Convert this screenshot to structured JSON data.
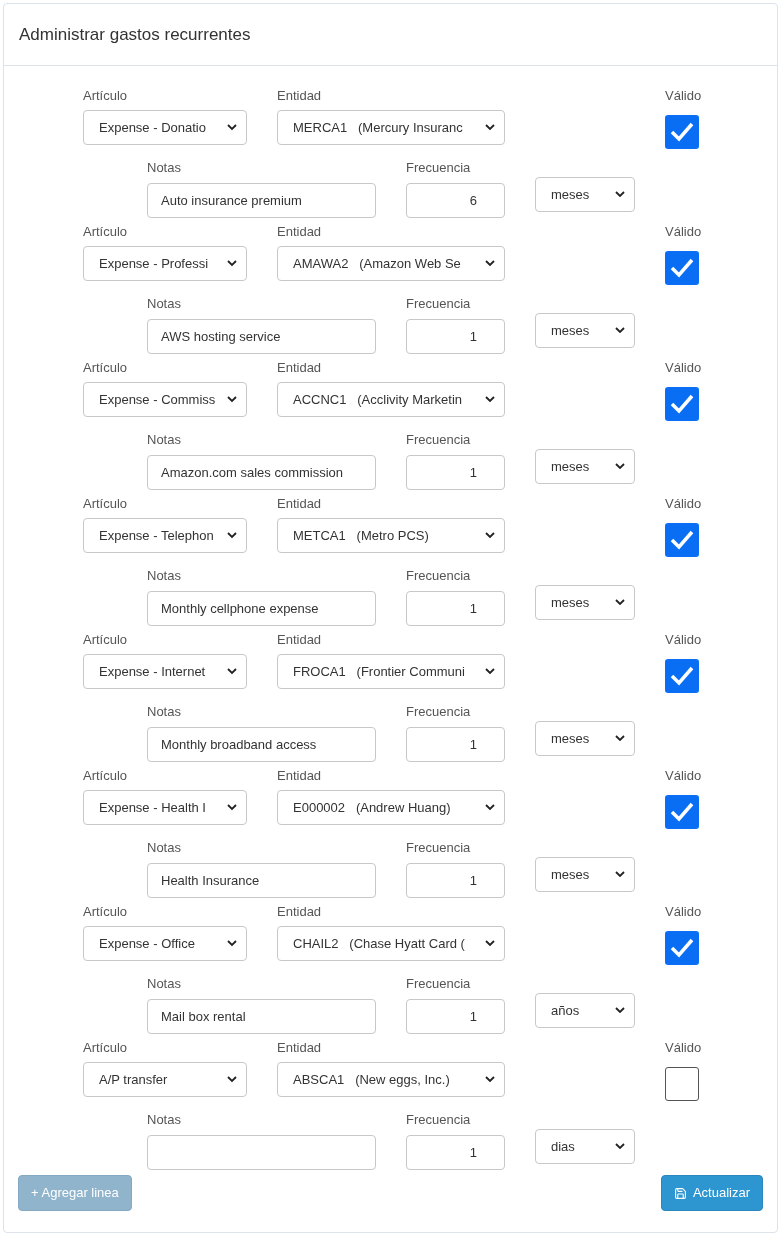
{
  "panel": {
    "title": "Administrar gastos recurrentes"
  },
  "rows": [
    {
      "item_label": "Artículo",
      "item": "Expense - Donatio",
      "entity_label": "Entidad",
      "entity": "MERCA1   (Mercury Insuranc",
      "valid_label": "Válido",
      "valid": true,
      "notes_label": "Notas",
      "notes": "Auto insurance premium",
      "frequency_label": "Frecuencia",
      "frequency": "6",
      "unit": "meses"
    },
    {
      "item_label": "Artículo",
      "item": "Expense - Professi",
      "entity_label": "Entidad",
      "entity": "AMAWA2   (Amazon Web Se",
      "valid_label": "Válido",
      "valid": true,
      "notes_label": "Notas",
      "notes": "AWS hosting service",
      "frequency_label": "Frecuencia",
      "frequency": "1",
      "unit": "meses"
    },
    {
      "item_label": "Artículo",
      "item": "Expense - Commiss",
      "entity_label": "Entidad",
      "entity": "ACCNC1   (Acclivity Marketin",
      "valid_label": "Válido",
      "valid": true,
      "notes_label": "Notas",
      "notes": "Amazon.com sales commission",
      "frequency_label": "Frecuencia",
      "frequency": "1",
      "unit": "meses"
    },
    {
      "item_label": "Artículo",
      "item": "Expense - Telephon",
      "entity_label": "Entidad",
      "entity": "METCA1   (Metro PCS)",
      "valid_label": "Válido",
      "valid": true,
      "notes_label": "Notas",
      "notes": "Monthly cellphone expense",
      "frequency_label": "Frecuencia",
      "frequency": "1",
      "unit": "meses"
    },
    {
      "item_label": "Artículo",
      "item": "Expense - Internet",
      "entity_label": "Entidad",
      "entity": "FROCA1   (Frontier Communi",
      "valid_label": "Válido",
      "valid": true,
      "notes_label": "Notas",
      "notes": "Monthly broadband access",
      "frequency_label": "Frecuencia",
      "frequency": "1",
      "unit": "meses"
    },
    {
      "item_label": "Artículo",
      "item": "Expense - Health I",
      "entity_label": "Entidad",
      "entity": "E000002   (Andrew Huang)",
      "valid_label": "Válido",
      "valid": true,
      "notes_label": "Notas",
      "notes": "Health Insurance",
      "frequency_label": "Frecuencia",
      "frequency": "1",
      "unit": "meses"
    },
    {
      "item_label": "Artículo",
      "item": "Expense - Office",
      "entity_label": "Entidad",
      "entity": "CHAIL2   (Chase Hyatt Card (",
      "valid_label": "Válido",
      "valid": true,
      "notes_label": "Notas",
      "notes": "Mail box rental",
      "frequency_label": "Frecuencia",
      "frequency": "1",
      "unit": "años"
    },
    {
      "item_label": "Artículo",
      "item": "A/P transfer",
      "entity_label": "Entidad",
      "entity": "ABSCA1   (New eggs, Inc.)",
      "valid_label": "Válido",
      "valid": false,
      "notes_label": "Notas",
      "notes": "",
      "frequency_label": "Frecuencia",
      "frequency": "1",
      "unit": "dias"
    }
  ],
  "add_button": {
    "label": "+ Agregar linea",
    "disabled": true
  },
  "update_button": {
    "label": "Actualizar"
  }
}
